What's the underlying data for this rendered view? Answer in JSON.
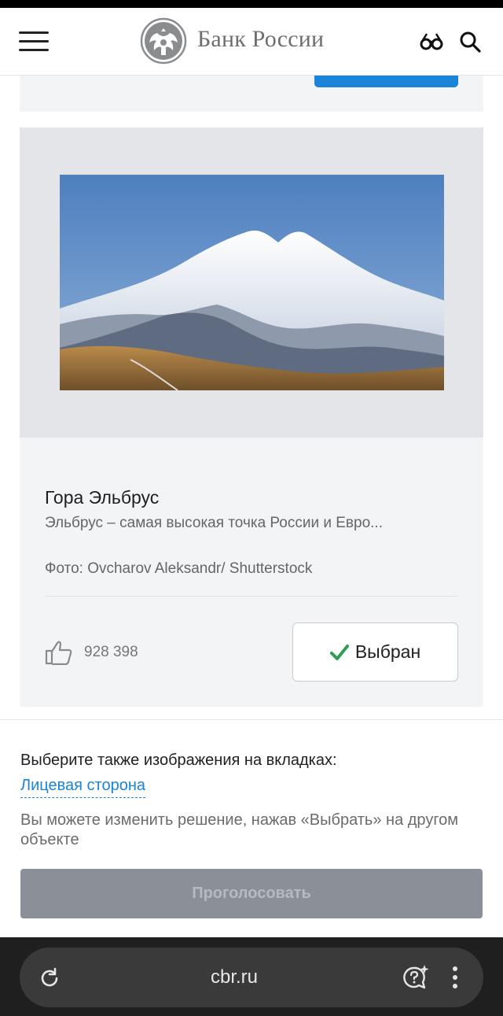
{
  "header": {
    "logo_text": "Банк России"
  },
  "card": {
    "title": "Гора Эльбрус",
    "description": "Эльбрус – самая высокая точка России и Евро...",
    "credit": "Фото: Ovcharov Aleksandr/ Shutterstock",
    "likes": "928 398",
    "select_label": "Выбран"
  },
  "bottom": {
    "choose_text": "Выберите также изображения на вкладках:",
    "tab_link": "Лицевая сторона",
    "hint": "Вы можете изменить решение, нажав «Выбрать» на другом объекте",
    "vote_label": "Проголосовать"
  },
  "browser": {
    "url": "cbr.ru"
  },
  "colors": {
    "accent": "#1a84d8",
    "check": "#2e9e4f",
    "disabled_button": "#8a8f98"
  }
}
